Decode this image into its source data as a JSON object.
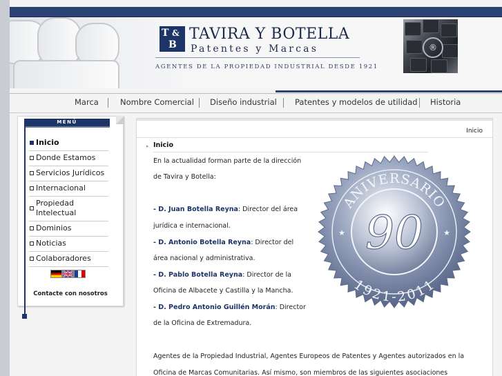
{
  "header": {
    "logo_initial_t": "T",
    "logo_amp": "&",
    "logo_initial_b": "B",
    "title": "TAVIRA Y BOTELLA",
    "subtitle": "Patentes y Marcas",
    "tagline": "AGENTES DE LA PROPIEDAD INDUSTRIAL DESDE 1921",
    "brand_color": "#1c3466"
  },
  "nav": [
    "Marca",
    "Nombre Comercial",
    "Diseño industrial",
    "Patentes y modelos de utilidad",
    "Historia"
  ],
  "sidebar": {
    "menu_title": "MENÚ",
    "items": [
      "Inicio",
      "Donde Estamos",
      "Servicios Jurídicos",
      "Internacional",
      "Propiedad\nIntelectual",
      "Dominios",
      "Noticias",
      "Colaboradores"
    ],
    "active_item": "Inicio",
    "flags": [
      "german-flag-icon",
      "uk-flag-icon",
      "french-flag-icon"
    ],
    "contact": "Contacte con nosotros"
  },
  "content": {
    "breadcrumb": "Inicio",
    "section_title": "Inicio",
    "intro_1": "En la actualidad forman parte de la dirección",
    "intro_2": "de Tavira y Botella:",
    "people": [
      {
        "name": "- D. Juan Botella Reyna",
        "role_1": ": Director del área",
        "role_2": "jurídica e internacional."
      },
      {
        "name": "- D. Antonio Botella Reyna",
        "role_1": ": Director del",
        "role_2": "área nacional y administrativa."
      },
      {
        "name": "- D. Pablo Botella Reyna",
        "role_1": ": Director de la",
        "role_2": "Oficina de Albacete y Castilla y la Mancha."
      },
      {
        "name": "- D. Pedro Antonio Guillén Morán",
        "role_1": ": Director",
        "role_2": "de la Oficina de Extremadura."
      }
    ],
    "para_1": "Agentes de la Propiedad Industrial, Agentes Europeos de Patentes y Agentes autorizados en la",
    "para_2": "Oficina de Marcas Comunitarias. Así mismo, son miembros de las siguientes asociaciones",
    "seal": {
      "number": "90",
      "top_text": "ANIVERSARIO",
      "bottom_text": "1921-2011"
    }
  }
}
